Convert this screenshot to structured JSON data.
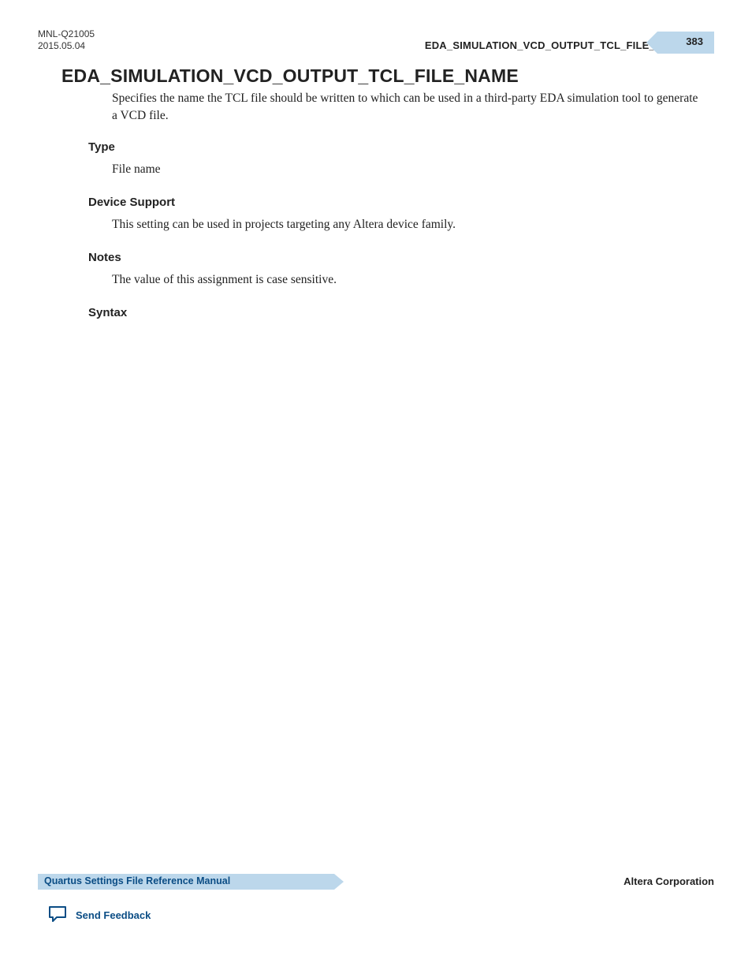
{
  "header": {
    "doc_code": "MNL-Q21005",
    "date": "2015.05.04",
    "running_title": "EDA_SIMULATION_VCD_OUTPUT_TCL_FILE_NAME",
    "page_number": "383"
  },
  "content": {
    "title": "EDA_SIMULATION_VCD_OUTPUT_TCL_FILE_NAME",
    "description": "Specifies the name the TCL file should be written to which can be used in a third-party EDA simulation tool to generate a VCD file.",
    "sections": {
      "type": {
        "heading": "Type",
        "body": "File name"
      },
      "device_support": {
        "heading": "Device Support",
        "body": "This setting can be used in projects targeting any Altera device family."
      },
      "notes": {
        "heading": "Notes",
        "body": "The value of this assignment is case sensitive."
      },
      "syntax": {
        "heading": "Syntax"
      }
    }
  },
  "footer": {
    "manual_name": "Quartus Settings File Reference Manual",
    "company": "Altera Corporation",
    "feedback_label": "Send Feedback"
  }
}
